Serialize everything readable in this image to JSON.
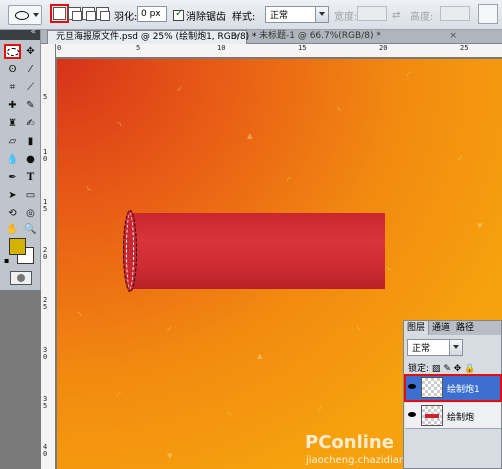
{
  "options_bar": {
    "feather_label": "羽化:",
    "feather_value": "0 px",
    "antialias_label": "消除锯齿",
    "style_label": "样式:",
    "style_value": "正常",
    "width_label": "宽度:",
    "height_label": "高度:"
  },
  "tabs": [
    {
      "label": "元旦海报原文件.psd @ 25% (绘制炮1, RGB/8) *",
      "close": "×"
    },
    {
      "label": "未标题-1 @ 66.7%(RGB/8) *",
      "close": "×"
    }
  ],
  "ruler_top": [
    "0",
    "5",
    "10",
    "15",
    "20",
    "25"
  ],
  "ruler_left": [
    "5",
    "1 0",
    "1 5",
    "2 0",
    "2 5",
    "3 0",
    "3 5",
    "4 0"
  ],
  "colors": {
    "foreground": "#d4b200",
    "background": "#ffffff",
    "selection_highlight": "#e01010"
  },
  "layers_panel": {
    "tabs": [
      "图层",
      "通道",
      "路径"
    ],
    "blend_mode": "正常",
    "lock_label": "锁定:",
    "layers": [
      {
        "name": "绘制炮1",
        "selected": true
      },
      {
        "name": "绘制炮",
        "selected": false
      }
    ]
  },
  "watermark": {
    "brand": "PConline",
    "sub": "jiaocheng.chazidian.com"
  }
}
